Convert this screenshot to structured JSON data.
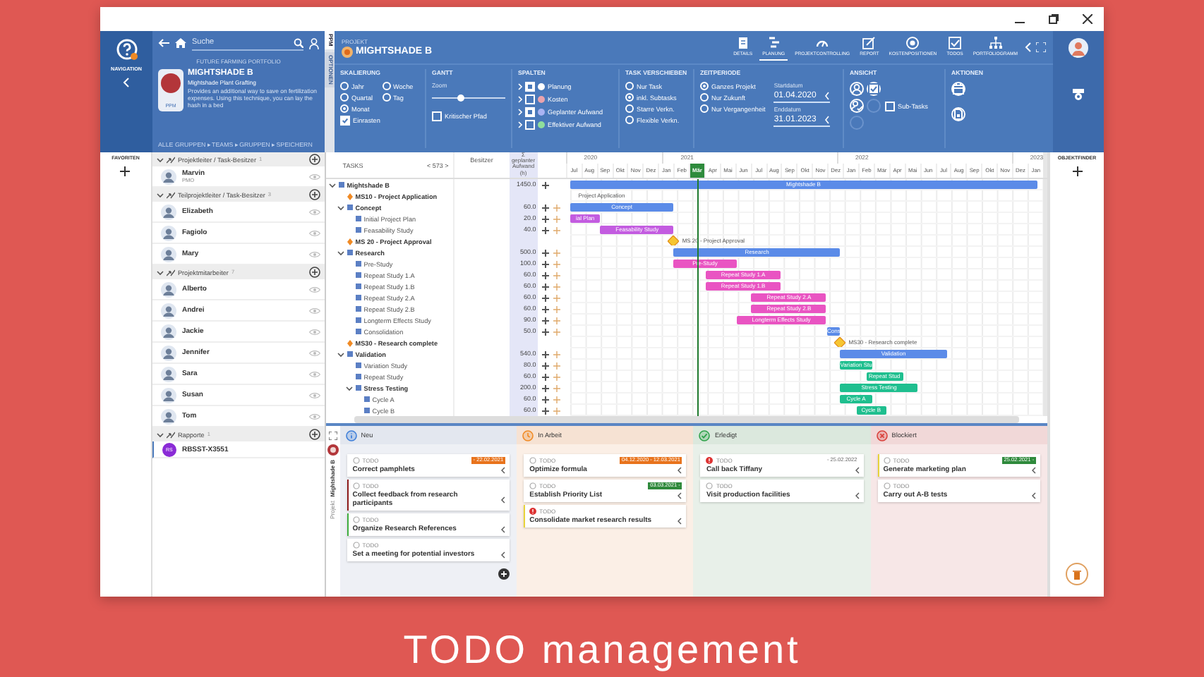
{
  "nav": {
    "label": "NAVIGATION"
  },
  "search": {
    "placeholder": "Suche"
  },
  "project_card": {
    "breadcrumb": "FUTURE FARMING PORTFOLIO",
    "title": "MIGHTSHADE B",
    "subtitle": "Mightshade Plant Grafting",
    "description": "Provides an additional way to save on fertilization expenses. Using this technique, you can lay the hash in a bed",
    "badge": "PPM",
    "footer": "ALLE GRUPPEN ▸ TEAMS ▸ GRUPPEN ▸ SPEICHERN"
  },
  "side_tabs": [
    {
      "label": "PPM",
      "selected": true
    },
    {
      "label": "OPTIONEN",
      "selected": false
    }
  ],
  "header": {
    "label": "PROJEKT",
    "project": "MIGHTSHADE B"
  },
  "tabs": [
    {
      "label": "DETAILS",
      "kind": "details",
      "selected": false
    },
    {
      "label": "PLANUNG",
      "kind": "planning",
      "selected": true
    },
    {
      "label": "PROJEKTCONTROLLING",
      "kind": "gauge",
      "selected": false
    },
    {
      "label": "REPORT",
      "kind": "report",
      "selected": false
    },
    {
      "label": "KOSTENPOSITIONEN",
      "kind": "coin",
      "selected": false
    },
    {
      "label": "TODOS",
      "kind": "todo",
      "selected": false
    },
    {
      "label": "PORTFOLIOGRAMM",
      "kind": "org",
      "selected": false
    }
  ],
  "ribbon": {
    "scaling": {
      "title": "SKALIERUNG",
      "options": [
        {
          "label": "Jahr",
          "selected": false
        },
        {
          "label": "Woche",
          "selected": false
        },
        {
          "label": "Quartal",
          "selected": false
        },
        {
          "label": "Tag",
          "selected": false
        },
        {
          "label": "Monat",
          "selected": true
        }
      ],
      "snap": {
        "label": "Einrasten",
        "checked": true
      }
    },
    "gantt_options": {
      "title": "GANTT",
      "zoom_label": "Zoom",
      "zoom": {
        "level": 0.4
      },
      "critical_path": {
        "label": "Kritischer Pfad",
        "checked": false
      }
    },
    "columns": {
      "title": "SPALTEN",
      "items": [
        {
          "label": "Planung",
          "checked": true,
          "color": "#ffffff"
        },
        {
          "label": "Kosten",
          "checked": false,
          "color": "#eaa3ad"
        },
        {
          "label": "Geplanter Aufwand",
          "checked": true,
          "color": "#a9b3f2"
        },
        {
          "label": "Effektiver Aufwand",
          "checked": false,
          "color": "#8fdf9c"
        }
      ]
    },
    "move": {
      "title": "TASK VERSCHIEBEN",
      "options": [
        {
          "label": "Nur Task",
          "selected": false
        },
        {
          "label": "inkl. Subtasks",
          "selected": true
        },
        {
          "label": "Starre Verkn.",
          "selected": false
        },
        {
          "label": "Flexible Verkn.",
          "selected": false
        }
      ]
    },
    "period": {
      "title": "ZEITPERIODE",
      "options": [
        {
          "label": "Ganzes Projekt",
          "selected": true
        },
        {
          "label": "Nur Zukunft",
          "selected": false
        },
        {
          "label": "Nur Vergangenheit",
          "selected": false
        }
      ],
      "start": {
        "label": "Startdatum",
        "value": "01.04.2020"
      },
      "end": {
        "label": "Enddatum",
        "value": "31.01.2023"
      }
    },
    "view": {
      "title": "ANSICHT",
      "buttons": [
        {
          "kind": "person",
          "selected": false
        },
        {
          "kind": "check",
          "selected": true
        },
        {
          "kind": "person_check",
          "selected": false
        }
      ],
      "sub_tasks": {
        "label": "Sub-Tasks",
        "checked": false
      }
    },
    "actions": {
      "title": "AKTIONEN",
      "buttons": [
        {
          "kind": "calendar"
        },
        {
          "kind": "file"
        }
      ]
    }
  },
  "favorites": {
    "label": "FAVORITEN"
  },
  "object_finder": {
    "label": "OBJEKTFINDER"
  },
  "team": [
    {
      "title": "Projektleiter / Task-Besitzer",
      "count": "1",
      "expanded": true,
      "members": [
        {
          "name": "Marvin",
          "role": "PMO",
          "kind": "person"
        }
      ]
    },
    {
      "title": "Teilprojektleiter / Task-Besitzer",
      "count": "3",
      "expanded": true,
      "members": [
        {
          "name": "Elizabeth",
          "kind": "person"
        },
        {
          "name": "Fagiolo",
          "kind": "person"
        },
        {
          "name": "Mary",
          "kind": "person"
        }
      ]
    },
    {
      "title": "Projektmitarbeiter",
      "count": "7",
      "expanded": true,
      "members": [
        {
          "name": "Alberto",
          "kind": "person"
        },
        {
          "name": "Andrei",
          "kind": "person"
        },
        {
          "name": "Jackie",
          "kind": "person"
        },
        {
          "name": "Jennifer",
          "kind": "person"
        },
        {
          "name": "Sara",
          "kind": "person"
        },
        {
          "name": "Susan",
          "kind": "person"
        },
        {
          "name": "Tom",
          "kind": "person"
        }
      ]
    },
    {
      "title": "Rapporte",
      "count": "1",
      "expanded": true,
      "members": [
        {
          "name": "RBSST-X3551",
          "initials": "RS",
          "kind": "report"
        }
      ]
    }
  ],
  "gantt": {
    "headers": {
      "tasks": "TASKS",
      "pager": "< 573 >",
      "owner": "Besitzer",
      "effort": "Σ geplanter Aufwand (h)"
    },
    "years": [
      {
        "label": "2020",
        "months": [
          {
            "label": "Jul",
            "selected": false
          },
          {
            "label": "Aug",
            "selected": false
          },
          {
            "label": "Sep",
            "selected": false
          },
          {
            "label": "Okt",
            "selected": false
          },
          {
            "label": "Nov",
            "selected": false
          },
          {
            "label": "Dez",
            "selected": false
          }
        ]
      },
      {
        "label": "2021",
        "months": [
          {
            "label": "Jan",
            "selected": false
          },
          {
            "label": "Feb",
            "selected": false
          },
          {
            "label": "Mär",
            "selected": true
          },
          {
            "label": "Apr",
            "selected": false
          },
          {
            "label": "Mai",
            "selected": false
          },
          {
            "label": "Jun",
            "selected": false
          },
          {
            "label": "Jul",
            "selected": false
          },
          {
            "label": "Aug",
            "selected": false
          },
          {
            "label": "Sep",
            "selected": false
          },
          {
            "label": "Okt",
            "selected": false
          },
          {
            "label": "Nov",
            "selected": false
          },
          {
            "label": "Dez",
            "selected": false
          }
        ]
      },
      {
        "label": "2022",
        "months": [
          {
            "label": "Jan",
            "selected": false
          },
          {
            "label": "Feb",
            "selected": false
          },
          {
            "label": "Mär",
            "selected": false
          },
          {
            "label": "Apr",
            "selected": false
          },
          {
            "label": "Mai",
            "selected": false
          },
          {
            "label": "Jun",
            "selected": false
          },
          {
            "label": "Jul",
            "selected": false
          },
          {
            "label": "Aug",
            "selected": false
          },
          {
            "label": "Sep",
            "selected": false
          },
          {
            "label": "Okt",
            "selected": false
          },
          {
            "label": "Nov",
            "selected": false
          },
          {
            "label": "Dez",
            "selected": false
          }
        ]
      },
      {
        "label": "2023",
        "months": [
          {
            "label": "Jan",
            "selected": false
          }
        ]
      }
    ],
    "tasks": [
      {
        "name": "Mightshade B",
        "kind": "group",
        "effort": "1450.0",
        "expanded": true,
        "bar": {
          "label": "Mightshade B",
          "color": "#5b8be8"
        },
        "children": [
          {
            "name": "MS10 - Project Application",
            "kind": "milestone",
            "milestone": {
              "label": "Project Application"
            }
          },
          {
            "name": "Concept",
            "kind": "group",
            "effort": "60.0",
            "expanded": true,
            "bar": {
              "label": "Concept",
              "color": "#5b8be8"
            },
            "children": [
              {
                "name": "Initial Project Plan",
                "kind": "task",
                "effort": "20.0",
                "bar": {
                  "label": "ial Plan",
                  "color": "#c35ce0"
                }
              },
              {
                "name": "Feasability Study",
                "kind": "task",
                "effort": "40.0",
                "bar": {
                  "label": "Feasability Study",
                  "color": "#c35ce0"
                }
              }
            ]
          },
          {
            "name": "MS 20 - Project Approval",
            "kind": "milestone",
            "milestone": {
              "label": "MS 20 - Project Approval"
            }
          },
          {
            "name": "Research",
            "kind": "group",
            "effort": "500.0",
            "expanded": true,
            "bar": {
              "label": "Research",
              "color": "#5b8be8"
            },
            "children": [
              {
                "name": "Pre-Study",
                "kind": "task",
                "effort": "100.0",
                "bar": {
                  "label": "Pre-Study",
                  "color": "#e954c2"
                }
              },
              {
                "name": "Repeat Study 1.A",
                "kind": "task",
                "effort": "60.0",
                "bar": {
                  "label": "Repeat Study 1.A",
                  "color": "#e954c2"
                }
              },
              {
                "name": "Repeat Study 1.B",
                "kind": "task",
                "effort": "60.0",
                "bar": {
                  "label": "Repeat Study 1.B",
                  "color": "#e954c2"
                }
              },
              {
                "name": "Repeat Study 2.A",
                "kind": "task",
                "effort": "60.0",
                "bar": {
                  "label": "Repeat Study 2.A",
                  "color": "#e954c2"
                }
              },
              {
                "name": "Repeat Study 2.B",
                "kind": "task",
                "effort": "60.0",
                "bar": {
                  "label": "Repeat Study 2.B",
                  "color": "#e954c2"
                }
              },
              {
                "name": "Longterm Effects Study",
                "kind": "task",
                "effort": "90.0",
                "bar": {
                  "label": "Longterm Effects Study",
                  "color": "#e954c2"
                }
              },
              {
                "name": "Consolidation",
                "kind": "task",
                "effort": "50.0",
                "bar": {
                  "label": "Cons",
                  "color": "#5b8be8"
                }
              }
            ]
          },
          {
            "name": "MS30 - Research complete",
            "kind": "milestone",
            "milestone": {
              "label": "MS30 - Research complete"
            }
          },
          {
            "name": "Validation",
            "kind": "group",
            "effort": "540.0",
            "expanded": true,
            "bar": {
              "label": "Validation",
              "color": "#5b8be8"
            },
            "children": [
              {
                "name": "Variation Study",
                "kind": "task",
                "effort": "80.0",
                "bar": {
                  "label": "Variation Stu",
                  "color": "#1fbf8f"
                }
              },
              {
                "name": "Repeat Study",
                "kind": "task",
                "effort": "60.0",
                "bar": {
                  "label": "Repeat Stud",
                  "color": "#1fbf8f"
                }
              },
              {
                "name": "Stress Testing",
                "kind": "group",
                "effort": "200.0",
                "expanded": true,
                "bar": {
                  "label": "Stress Testing",
                  "color": "#1fbf8f"
                },
                "children": [
                  {
                    "name": "Cycle A",
                    "kind": "task",
                    "effort": "60.0",
                    "bar": {
                      "label": "Cycle A",
                      "color": "#1fbf8f"
                    }
                  },
                  {
                    "name": "Cycle B",
                    "kind": "task",
                    "effort": "60.0",
                    "bar": {
                      "label": "Cycle B",
                      "color": "#1fbf8f"
                    }
                  }
                ]
              }
            ]
          }
        ]
      }
    ]
  },
  "board": {
    "project": {
      "name": "Mightshade B",
      "label": "Projekt"
    },
    "columns": [
      {
        "title": "Neu",
        "kind": "new",
        "cards": [
          {
            "label": "TODO",
            "title": "Correct pamphlets",
            "date": {
              "text": "- 22.02.2021",
              "color": "#e8731c"
            },
            "priority": false
          },
          {
            "label": "TODO",
            "title": "Collect feedback from research participants",
            "color": "#8e1b1b",
            "priority": false
          },
          {
            "label": "TODO",
            "title": "Organize Research References",
            "color": "#3fae3f",
            "priority": false
          },
          {
            "label": "TODO",
            "title": "Set a meeting for potential investors",
            "priority": false
          }
        ]
      },
      {
        "title": "In Arbeit",
        "kind": "progress",
        "cards": [
          {
            "label": "TODO",
            "title": "Optimize formula",
            "date": {
              "text": "04.12.2020 - 12.03.2021",
              "color": "#e8731c"
            },
            "priority": false
          },
          {
            "label": "TODO",
            "title": "Establish Priority List",
            "date": {
              "text": "03.03.2021 -",
              "color": "#2f8a3c"
            },
            "priority": false
          },
          {
            "label": "TODO",
            "title": "Consolidate market research results",
            "color": "#e8d33a",
            "priority": true
          }
        ]
      },
      {
        "title": "Erledigt",
        "kind": "done",
        "cards": [
          {
            "label": "TODO",
            "title": "Call back Tiffany",
            "date": {
              "text": "- 25.02.2022"
            },
            "priority": true
          },
          {
            "label": "TODO",
            "title": "Visit production facilities",
            "priority": false
          }
        ]
      },
      {
        "title": "Blockiert",
        "kind": "blocked",
        "cards": [
          {
            "label": "TODO",
            "title": "Generate marketing plan",
            "color": "#e8d33a",
            "date": {
              "text": "25.02.2021 -",
              "color": "#2f8a3c"
            },
            "priority": false
          },
          {
            "label": "TODO",
            "title": "Carry out A-B tests",
            "priority": false
          }
        ]
      }
    ]
  },
  "caption": "TODO management"
}
